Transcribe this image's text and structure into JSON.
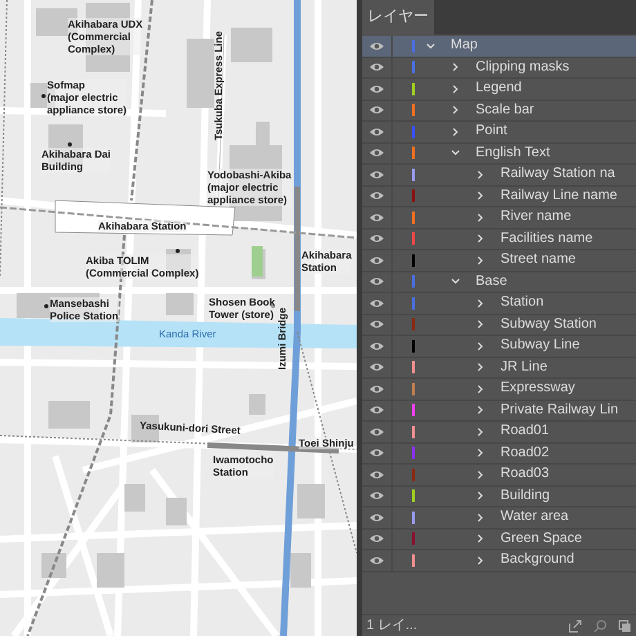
{
  "map_labels": [
    {
      "kind": "poi",
      "text": "Akihabara UDX\n(Commercial\nComplex)"
    },
    {
      "kind": "poi_dot",
      "text": "Sofmap\n(major electric\nappliance store)"
    },
    {
      "kind": "poi_dot",
      "text": "Akihabara Dai\nBuilding"
    },
    {
      "kind": "line_vertical",
      "text": "Tsukuba Express Line"
    },
    {
      "kind": "poi",
      "text": "Yodobashi-Akiba\n(major electric\nappliance store)"
    },
    {
      "kind": "poi",
      "text": "Akihabara Station"
    },
    {
      "kind": "poi_dot",
      "text": "Akiba TOLIM\n(Commercial Complex)"
    },
    {
      "kind": "poi",
      "text": "Akihabara\nStation"
    },
    {
      "kind": "poi_dot",
      "text": "Mansebashi\nPolice Station"
    },
    {
      "kind": "poi_dot",
      "text": "Shosen Book\nTower (store)"
    },
    {
      "kind": "river",
      "text": "Kanda River"
    },
    {
      "kind": "line_vertical",
      "text": "Izumi Bridge"
    },
    {
      "kind": "street",
      "text": "Yasukuni-dori Street"
    },
    {
      "kind": "poi",
      "text": "Toei Shinju"
    },
    {
      "kind": "poi",
      "text": "Iwamotocho\nStation"
    }
  ],
  "layers_panel": {
    "tab": "レイヤー",
    "footer": "1 レイ...",
    "layers": [
      {
        "name": "Map",
        "color": "#4a6fe0",
        "expanded": true,
        "selected": true,
        "children": [
          {
            "name": "Clipping masks",
            "color": "#4a6fe0",
            "expanded": false,
            "selected": false
          },
          {
            "name": "Legend",
            "color": "#a0d020",
            "expanded": false,
            "selected": false
          },
          {
            "name": "Scale bar",
            "color": "#f07020",
            "expanded": false,
            "selected": false
          },
          {
            "name": "Point",
            "color": "#3a50ff",
            "expanded": false,
            "selected": false
          },
          {
            "name": "English Text",
            "color": "#f07020",
            "expanded": true,
            "selected": false,
            "children": [
              {
                "name": "Railway Station na",
                "color": "#9a9af0",
                "expanded": false,
                "selected": false
              },
              {
                "name": "Railway Line name",
                "color": "#8a1010",
                "expanded": false,
                "selected": false
              },
              {
                "name": "River name",
                "color": "#f07020",
                "expanded": false,
                "selected": false
              },
              {
                "name": "Facilities name",
                "color": "#f04848",
                "expanded": false,
                "selected": false
              },
              {
                "name": "Street name",
                "color": "#000000",
                "expanded": false,
                "selected": false
              }
            ]
          },
          {
            "name": "Base",
            "color": "#4a6fe0",
            "expanded": true,
            "selected": false,
            "children": [
              {
                "name": "Station",
                "color": "#4a6fe0",
                "expanded": false,
                "selected": false
              },
              {
                "name": "Subway Station",
                "color": "#8a2a10",
                "expanded": false,
                "selected": false
              },
              {
                "name": "Subway Line",
                "color": "#000000",
                "expanded": false,
                "selected": false
              },
              {
                "name": "JR Line",
                "color": "#f09090",
                "expanded": false,
                "selected": false
              },
              {
                "name": "Expressway",
                "color": "#c08050",
                "expanded": false,
                "selected": false
              },
              {
                "name": "Private Railway Lin",
                "color": "#f040f0",
                "expanded": false,
                "selected": false
              },
              {
                "name": "Road01",
                "color": "#f09090",
                "expanded": false,
                "selected": false
              },
              {
                "name": "Road02",
                "color": "#8a30f0",
                "expanded": false,
                "selected": false
              },
              {
                "name": "Road03",
                "color": "#8a2a10",
                "expanded": false,
                "selected": false
              },
              {
                "name": "Building",
                "color": "#a0d020",
                "expanded": false,
                "selected": false
              },
              {
                "name": "Water area",
                "color": "#9a9af0",
                "expanded": false,
                "selected": false
              },
              {
                "name": "Green Space",
                "color": "#8a1030",
                "expanded": false,
                "selected": false
              },
              {
                "name": "Background",
                "color": "#f09090",
                "expanded": false,
                "selected": false
              }
            ]
          }
        ]
      }
    ]
  }
}
